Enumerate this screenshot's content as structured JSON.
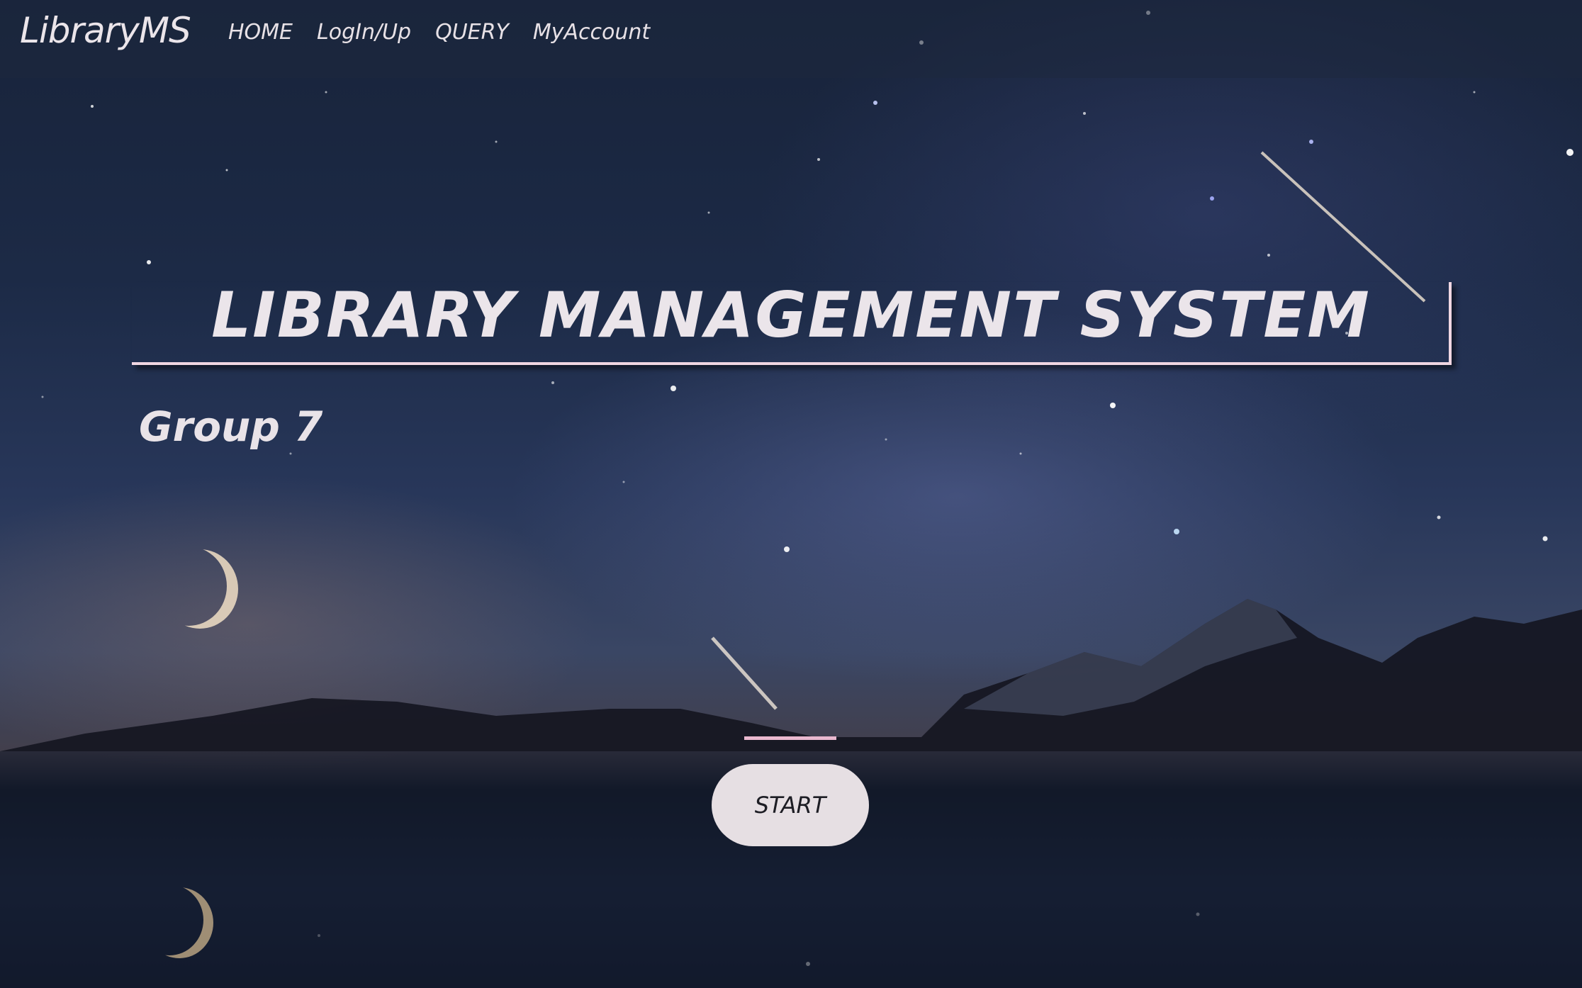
{
  "navbar": {
    "brand": "LibraryMS",
    "links": [
      "HOME",
      "LogIn/Up",
      "QUERY",
      "MyAccount"
    ]
  },
  "hero": {
    "title": "LIBRARY MANAGEMENT SYSTEM",
    "subtitle": "Group 7",
    "start_label": "START"
  },
  "colors": {
    "accent_line": "#e9b8cf",
    "button_bg": "#e6dfe3",
    "text": "#ebe5ea"
  }
}
